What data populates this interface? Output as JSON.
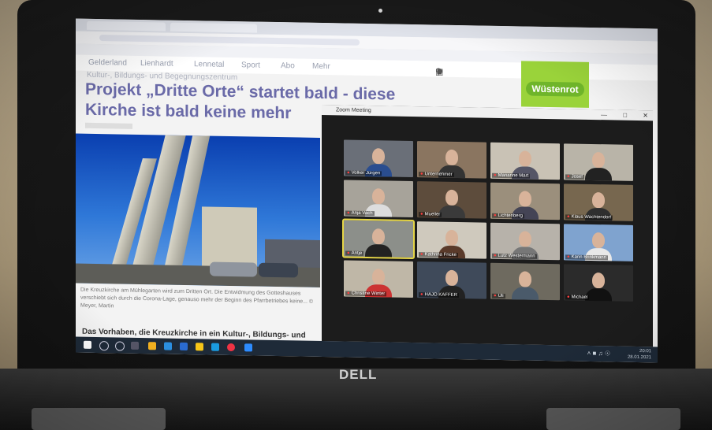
{
  "nav": {
    "items": [
      "Gelderland",
      "Lienhardt",
      "Lennetal",
      "Sport",
      "Abo",
      "Mehr"
    ]
  },
  "breadcrumb": "Kultur-, Bildungs- und Begegnungszentrum",
  "article": {
    "headline_1": "Projekt „Dritte Orte“ startet bald - diese",
    "headline_2": "Kirche ist bald keine mehr",
    "caption": "Die Kreuzkirche am Mühlegarten wird zum Dritten Ort. Die Entwidmung des Gotteshauses verschiebt sich durch die Corona-Lage, genauso mehr der Beginn des Pfarrbetriebes keine... © Meyer, Martin",
    "body": "Das Vorhaben, die Kreuzkirche in ein Kultur-, Bildungs- und"
  },
  "ad": {
    "label": "Wüstenrot"
  },
  "zoom": {
    "title": "Zoom Meeting",
    "participants": [
      {
        "name": "Volker Jürgen"
      },
      {
        "name": "Unternehmer"
      },
      {
        "name": "Marianne Mart"
      },
      {
        "name": "Josef"
      },
      {
        "name": "Anja Vach"
      },
      {
        "name": "Mueller"
      },
      {
        "name": "Lichtenberg"
      },
      {
        "name": "Klaus Wachtendorf"
      },
      {
        "name": "Antje"
      },
      {
        "name": "Kathrina Fricke"
      },
      {
        "name": "Lutz Westermann"
      },
      {
        "name": "Karin Brinkmann"
      },
      {
        "name": "Christine Winter"
      },
      {
        "name": "HAJO KAFFER"
      },
      {
        "name": "Uli"
      },
      {
        "name": "Michael"
      }
    ]
  },
  "taskbar": {
    "time": "20:01",
    "date": "28.01.2021"
  },
  "brand": "DELL"
}
